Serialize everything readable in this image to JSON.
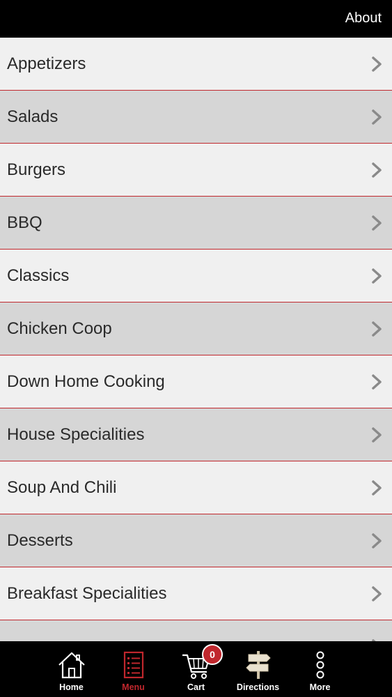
{
  "header": {
    "about_label": "About"
  },
  "menu": {
    "items": [
      {
        "label": "Appetizers"
      },
      {
        "label": "Salads"
      },
      {
        "label": "Burgers"
      },
      {
        "label": "BBQ"
      },
      {
        "label": "Classics"
      },
      {
        "label": "Chicken Coop"
      },
      {
        "label": "Down Home Cooking"
      },
      {
        "label": "House Specialities"
      },
      {
        "label": "Soup And Chili"
      },
      {
        "label": "Desserts"
      },
      {
        "label": "Breakfast Specialities"
      },
      {
        "label": ""
      }
    ]
  },
  "tabs": {
    "home": {
      "label": "Home",
      "icon": "home-icon"
    },
    "menu": {
      "label": "Menu",
      "icon": "menu-list-icon"
    },
    "cart": {
      "label": "Cart",
      "icon": "cart-icon",
      "badge": "0"
    },
    "directions": {
      "label": "Directions",
      "icon": "signpost-icon"
    },
    "more": {
      "label": "More",
      "icon": "more-dots-icon"
    }
  },
  "colors": {
    "accent": "#c0272d",
    "row_light": "#f0f0f0",
    "row_dark": "#d6d6d6",
    "bar": "#000000"
  }
}
